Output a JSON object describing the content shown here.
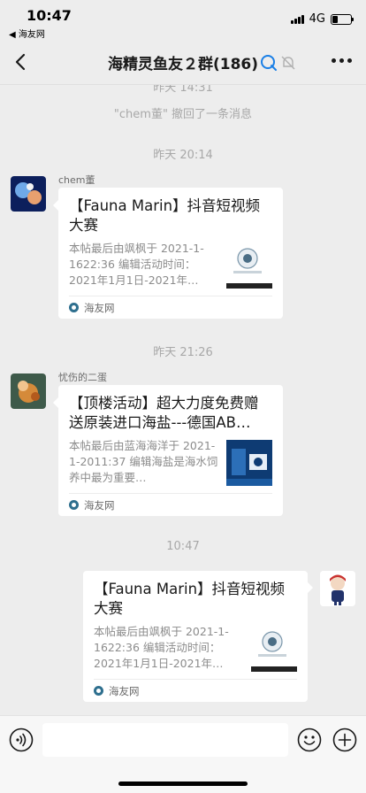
{
  "status_bar": {
    "time": "10:47",
    "back_app": "◀ 海友网",
    "network": "4G",
    "battery_level": 0.3
  },
  "nav": {
    "title": "海精灵鱼友２群(186)"
  },
  "chat": {
    "partial_time": "昨天 14:31",
    "recall_message": "\"chem董\" 撤回了一条消息",
    "time_1": "昨天 20:14",
    "time_2": "昨天 21:26",
    "time_3": "10:47",
    "messages": [
      {
        "sender": "chem董",
        "title": "【Fauna Marin】抖音短视频大赛",
        "desc": "本帖最后由飒枫于 2021-1-1622:36 编辑活动时间：2021年1月1日-2021年…",
        "source": "海友网"
      },
      {
        "sender": "忧伤的二蛋",
        "title": "【顶楼活动】超大力度免费赠送原装进口海盐---德国AB…",
        "desc": "本帖最后由蓝海海洋于 2021-1-2011:37 编辑海盐是海水饲养中最为重要…",
        "source": "海友网"
      },
      {
        "sender": "",
        "title": "【Fauna Marin】抖音短视频大赛",
        "desc": "本帖最后由飒枫于 2021-1-1622:36 编辑活动时间：2021年1月1日-2021年…",
        "source": "海友网"
      }
    ]
  },
  "input": {
    "placeholder": ""
  }
}
